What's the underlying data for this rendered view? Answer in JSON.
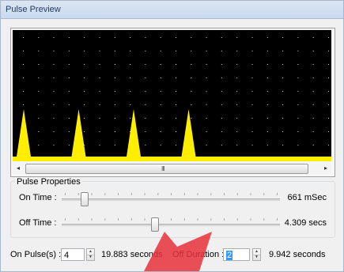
{
  "window": {
    "title": "Pulse Preview"
  },
  "preview": {
    "background_color": "#000000",
    "pulse_color": "#ffee00",
    "grid_dot_color": "#d0d0d0",
    "pulse_count": 4,
    "scrollbar": {
      "left_arrow": "◂",
      "right_arrow": "▸",
      "grip": "III"
    }
  },
  "pulse_properties": {
    "title": "Pulse Properties",
    "on_time": {
      "label": "On Time :",
      "value": "661 mSec",
      "slider_fraction": 0.09
    },
    "off_time": {
      "label": "Off Time :",
      "value": "4.309 secs",
      "slider_fraction": 0.42
    }
  },
  "bottom": {
    "on_pulses": {
      "label": "On Pulse(s) :",
      "value": "4",
      "result": "19.883 seconds"
    },
    "off_duration": {
      "label": "Off Duration :",
      "value": "2",
      "result": "9.942 seconds"
    },
    "spin_up": "▲",
    "spin_down": "▼"
  },
  "overlay": {
    "arrow_color": "#e8303a"
  }
}
